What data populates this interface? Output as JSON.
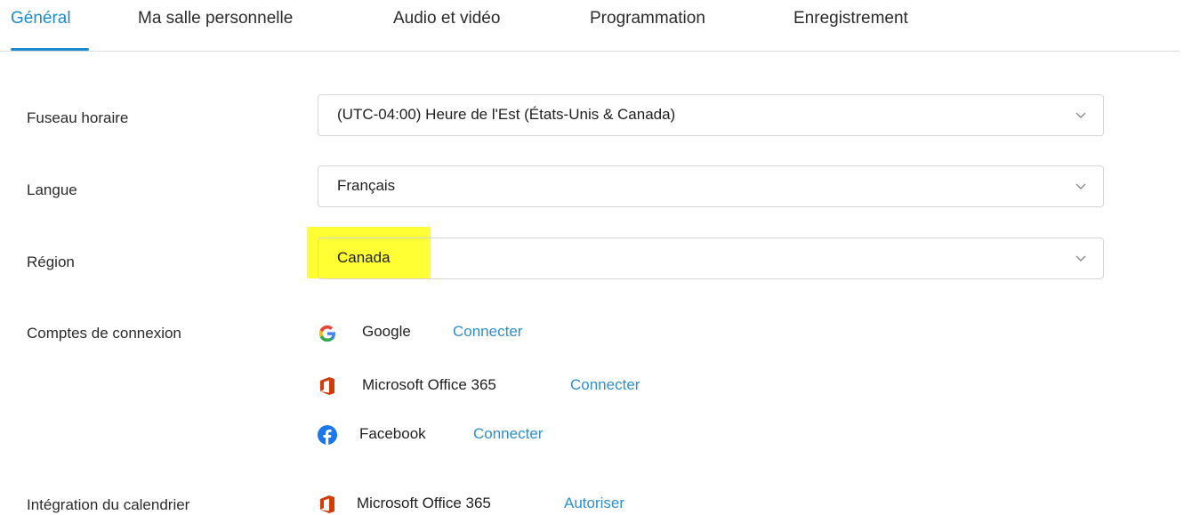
{
  "tabs": [
    {
      "label": "Général",
      "active": true
    },
    {
      "label": "Ma salle personnelle",
      "active": false
    },
    {
      "label": "Audio et vidéo",
      "active": false
    },
    {
      "label": "Programmation",
      "active": false
    },
    {
      "label": "Enregistrement",
      "active": false
    }
  ],
  "settings": {
    "timezone": {
      "label": "Fuseau horaire",
      "value": "(UTC-04:00) Heure de l'Est (États-Unis & Canada)"
    },
    "language": {
      "label": "Langue",
      "value": "Français"
    },
    "region": {
      "label": "Région",
      "value": "Canada"
    }
  },
  "accounts": {
    "label": "Comptes de connexion",
    "items": [
      {
        "name": "Google",
        "action": "Connecter",
        "icon": "google-icon"
      },
      {
        "name": "Microsoft Office 365",
        "action": "Connecter",
        "icon": "office-icon"
      },
      {
        "name": "Facebook",
        "action": "Connecter",
        "icon": "facebook-icon"
      }
    ]
  },
  "calendar": {
    "label": "Intégration du calendrier",
    "items": [
      {
        "name": "Microsoft Office 365",
        "action": "Autoriser",
        "icon": "office-icon"
      }
    ]
  },
  "colors": {
    "accent": "#1a8ccc",
    "link": "#2e8fd0",
    "highlight": "#ffff33",
    "office": "#d83b01",
    "facebook": "#1877f2"
  }
}
